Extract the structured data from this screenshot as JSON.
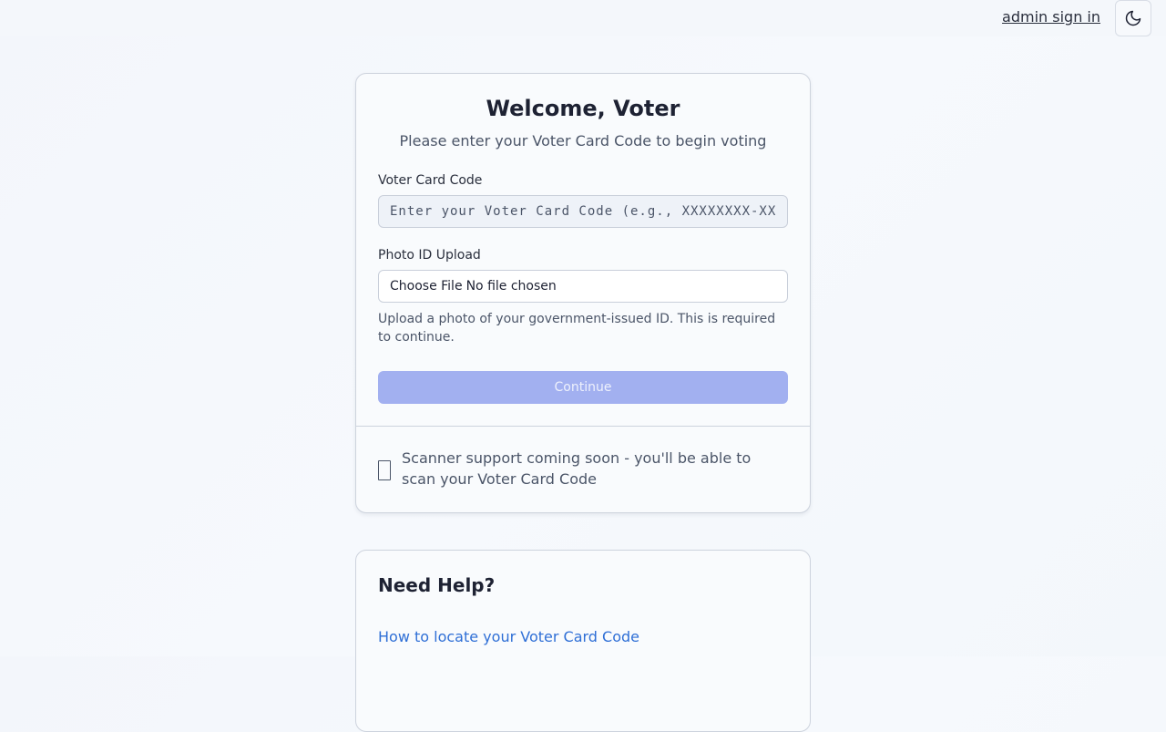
{
  "header": {
    "admin_link": "admin sign in",
    "theme_toggle_icon": "moon-icon"
  },
  "welcome_card": {
    "title": "Welcome, Voter",
    "subtitle": "Please enter your Voter Card Code to begin voting",
    "code_label": "Voter Card Code",
    "code_placeholder": "Enter your Voter Card Code (e.g., XXXXXXXX-XXXX)",
    "photo_label": "Photo ID Upload",
    "file_button": "Choose File",
    "file_status": "No file chosen",
    "photo_help": "Upload a photo of your government-issued ID. This is required to continue.",
    "continue_label": "Continue",
    "scanner_icon": "scanner-icon",
    "scanner_text": "Scanner support coming soon - you'll be able to scan your Voter Card Code"
  },
  "help_card": {
    "title": "Need Help?",
    "link_label": "How to locate your Voter Card Code"
  },
  "colors": {
    "button_disabled": "#a2b0f0",
    "link": "#2f6fd6",
    "text_primary": "#1e2233",
    "text_secondary": "#4b5568"
  }
}
